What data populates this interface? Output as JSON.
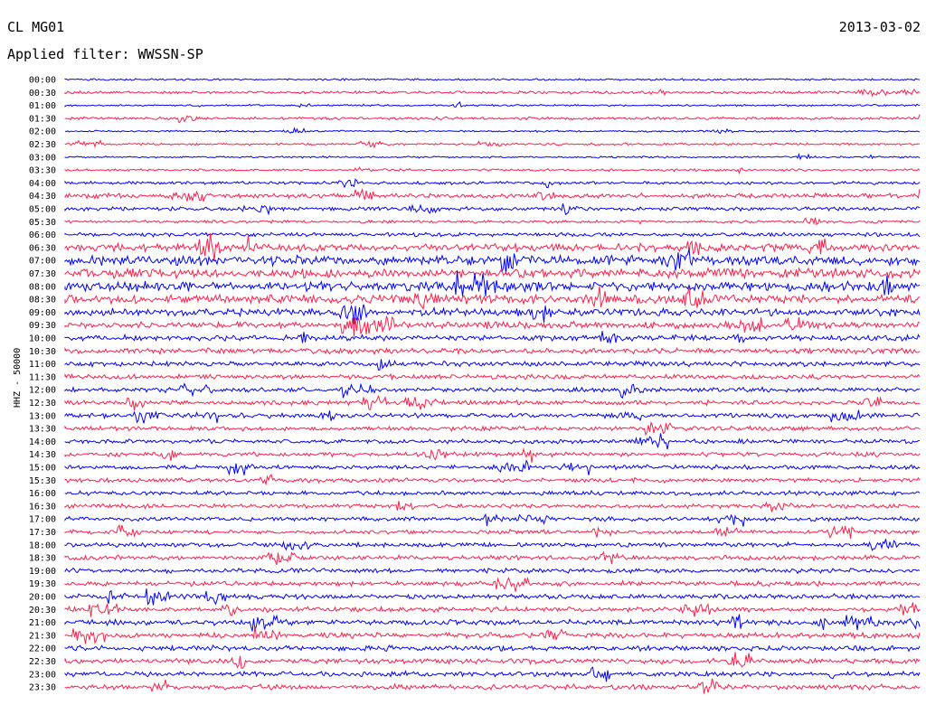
{
  "header": {
    "station": "CL MG01",
    "date": "2013-03-02",
    "filter": "Applied filter: WWSSN-SP"
  },
  "chart_data": {
    "type": "line",
    "subtype": "helicorder",
    "ylabel": "HHZ - 50000",
    "trace_colors": [
      "#0000ff",
      "#ff1f4b"
    ],
    "rows": [
      {
        "label": "00:00",
        "amplitude": 1.0
      },
      {
        "label": "00:30",
        "amplitude": 1.5
      },
      {
        "label": "01:00",
        "amplitude": 1.0
      },
      {
        "label": "01:30",
        "amplitude": 1.5
      },
      {
        "label": "02:00",
        "amplitude": 1.0
      },
      {
        "label": "02:30",
        "amplitude": 1.2
      },
      {
        "label": "03:00",
        "amplitude": 1.0
      },
      {
        "label": "03:30",
        "amplitude": 1.2
      },
      {
        "label": "04:00",
        "amplitude": 1.6
      },
      {
        "label": "04:30",
        "amplitude": 2.5
      },
      {
        "label": "05:00",
        "amplitude": 2.0
      },
      {
        "label": "05:30",
        "amplitude": 1.4
      },
      {
        "label": "06:00",
        "amplitude": 2.0
      },
      {
        "label": "06:30",
        "amplitude": 4.0
      },
      {
        "label": "07:00",
        "amplitude": 5.0
      },
      {
        "label": "07:30",
        "amplitude": 5.0
      },
      {
        "label": "08:00",
        "amplitude": 5.0
      },
      {
        "label": "08:30",
        "amplitude": 4.5
      },
      {
        "label": "09:00",
        "amplitude": 4.0
      },
      {
        "label": "09:30",
        "amplitude": 3.5
      },
      {
        "label": "10:00",
        "amplitude": 3.0
      },
      {
        "label": "10:30",
        "amplitude": 2.8
      },
      {
        "label": "11:00",
        "amplitude": 2.5
      },
      {
        "label": "11:30",
        "amplitude": 2.4
      },
      {
        "label": "12:00",
        "amplitude": 2.4
      },
      {
        "label": "12:30",
        "amplitude": 2.4
      },
      {
        "label": "13:00",
        "amplitude": 2.4
      },
      {
        "label": "13:30",
        "amplitude": 2.3
      },
      {
        "label": "14:00",
        "amplitude": 2.3
      },
      {
        "label": "14:30",
        "amplitude": 2.3
      },
      {
        "label": "15:00",
        "amplitude": 2.3
      },
      {
        "label": "15:30",
        "amplitude": 2.3
      },
      {
        "label": "16:00",
        "amplitude": 2.3
      },
      {
        "label": "16:30",
        "amplitude": 2.2
      },
      {
        "label": "17:00",
        "amplitude": 2.2
      },
      {
        "label": "17:30",
        "amplitude": 2.2
      },
      {
        "label": "18:00",
        "amplitude": 2.3
      },
      {
        "label": "18:30",
        "amplitude": 2.4
      },
      {
        "label": "19:00",
        "amplitude": 2.4
      },
      {
        "label": "19:30",
        "amplitude": 2.4
      },
      {
        "label": "20:00",
        "amplitude": 2.5
      },
      {
        "label": "20:30",
        "amplitude": 2.6
      },
      {
        "label": "21:00",
        "amplitude": 2.8
      },
      {
        "label": "21:30",
        "amplitude": 2.8
      },
      {
        "label": "22:00",
        "amplitude": 2.7
      },
      {
        "label": "22:30",
        "amplitude": 2.7
      },
      {
        "label": "23:00",
        "amplitude": 2.6
      },
      {
        "label": "23:30",
        "amplitude": 2.6
      }
    ]
  }
}
